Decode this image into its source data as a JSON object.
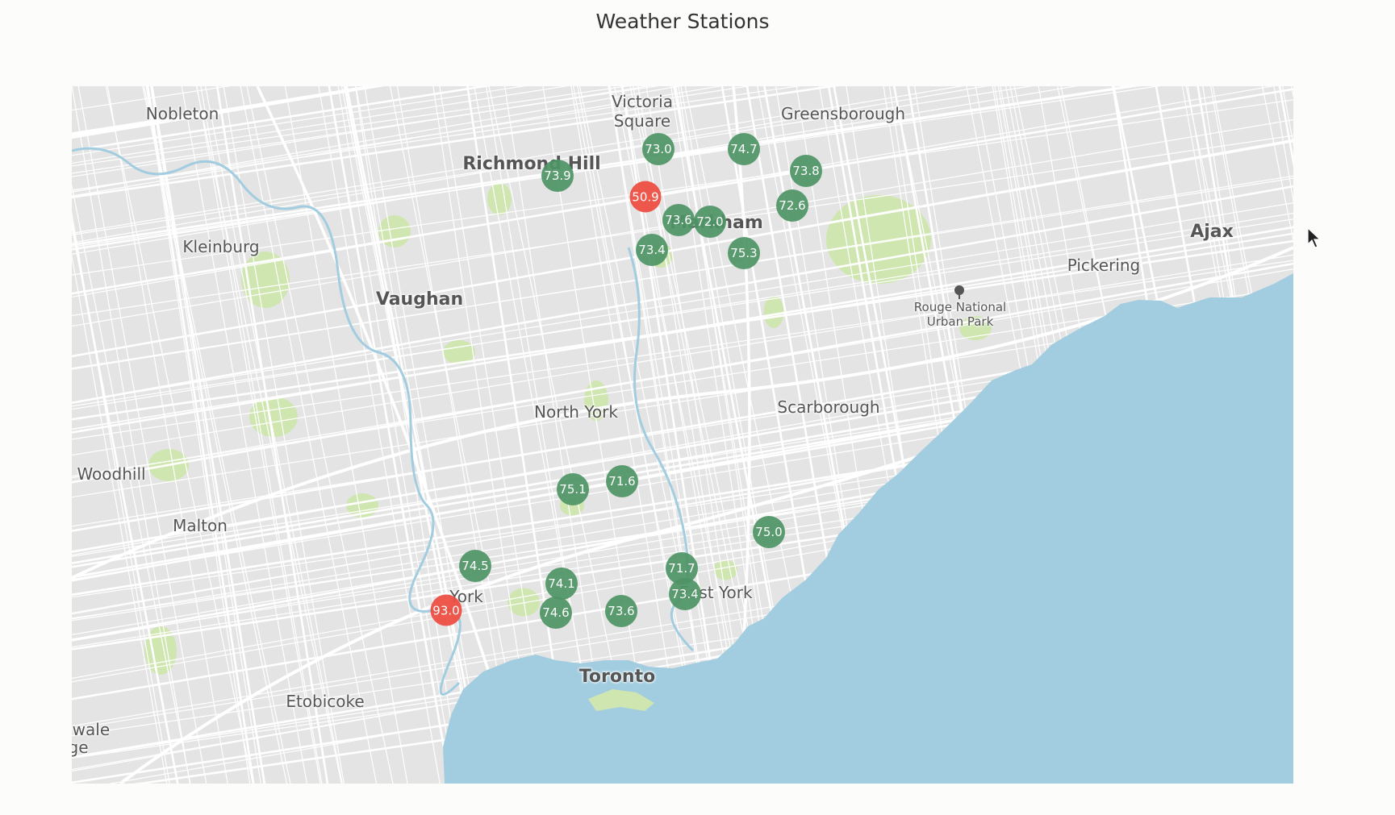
{
  "title": "Weather Stations",
  "map": {
    "places": [
      {
        "id": "nobleton",
        "label": "Nobleton",
        "type": "normal"
      },
      {
        "id": "victoria-square",
        "label": "Victoria\nSquare",
        "type": "normal"
      },
      {
        "id": "greensborough",
        "label": "Greensborough",
        "type": "normal"
      },
      {
        "id": "richmond-hill",
        "label": "Richmond Hill",
        "type": "major"
      },
      {
        "id": "markham",
        "label": "Markham",
        "type": "major"
      },
      {
        "id": "kleinburg",
        "label": "Kleinburg",
        "type": "normal"
      },
      {
        "id": "vaughan",
        "label": "Vaughan",
        "type": "major"
      },
      {
        "id": "ajax",
        "label": "Ajax",
        "type": "major"
      },
      {
        "id": "pickering",
        "label": "Pickering",
        "type": "normal"
      },
      {
        "id": "rouge-park",
        "label": "Rouge National\nUrban Park",
        "type": "small"
      },
      {
        "id": "north-york",
        "label": "North York",
        "type": "normal"
      },
      {
        "id": "scarborough",
        "label": "Scarborough",
        "type": "normal"
      },
      {
        "id": "woodhill",
        "label": "Woodhill",
        "type": "normal"
      },
      {
        "id": "malton",
        "label": "Malton",
        "type": "normal"
      },
      {
        "id": "east-york",
        "label": "East York",
        "type": "normal"
      },
      {
        "id": "york",
        "label": "York",
        "type": "normal"
      },
      {
        "id": "toronto",
        "label": "Toronto",
        "type": "major"
      },
      {
        "id": "etobicoke",
        "label": "Etobicoke",
        "type": "normal"
      },
      {
        "id": "brampton-edge",
        "label": "vwale",
        "type": "normal"
      },
      {
        "id": "brampton-edge-2",
        "label": "ge",
        "type": "normal"
      }
    ],
    "markers": [
      {
        "value": "73.0",
        "status": "normal"
      },
      {
        "value": "74.7",
        "status": "normal"
      },
      {
        "value": "73.8",
        "status": "normal"
      },
      {
        "value": "73.9",
        "status": "normal"
      },
      {
        "value": "50.9",
        "status": "alert"
      },
      {
        "value": "72.6",
        "status": "normal"
      },
      {
        "value": "73.6",
        "status": "normal"
      },
      {
        "value": "72.0",
        "status": "normal"
      },
      {
        "value": "73.4",
        "status": "normal"
      },
      {
        "value": "75.3",
        "status": "normal"
      },
      {
        "value": "75.1",
        "status": "normal"
      },
      {
        "value": "71.6",
        "status": "normal"
      },
      {
        "value": "75.0",
        "status": "normal"
      },
      {
        "value": "74.5",
        "status": "normal"
      },
      {
        "value": "71.7",
        "status": "normal"
      },
      {
        "value": "74.1",
        "status": "normal"
      },
      {
        "value": "73.4",
        "status": "normal"
      },
      {
        "value": "93.0",
        "status": "alert"
      },
      {
        "value": "74.6",
        "status": "normal"
      },
      {
        "value": "73.6",
        "status": "normal"
      }
    ],
    "colors": {
      "land": "#e4e4e4",
      "water": "#a2cde0",
      "park": "#cfe6b0",
      "road": "#ffffff",
      "marker_normal": "#4f9466",
      "marker_alert": "#ee4b3e"
    }
  }
}
